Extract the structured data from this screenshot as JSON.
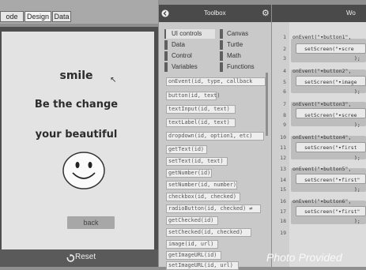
{
  "mode_tabs": [
    "ode",
    "Design",
    "Data"
  ],
  "app_screen": {
    "line1": "smile",
    "line2": "Be the change",
    "line3": "your beautiful",
    "back_label": "back",
    "reset_label": "Reset"
  },
  "toolbox": {
    "title": "Toolbox",
    "categories_left": [
      "UI controls",
      "Data",
      "Control",
      "Variables"
    ],
    "categories_right": [
      "Canvas",
      "Turtle",
      "Math",
      "Functions"
    ],
    "blocks": [
      "onEvent(id, type, callback",
      "button(id, text)",
      "textInput(id, text)",
      "textLabel(id, text)",
      "dropdown(id, option1, etc)",
      "getText(id)",
      "setText(id, text)",
      "getNumber(id)",
      "setNumber(id, number)",
      "checkbox(id, checked)",
      "radioButton(id, checked) ⇄",
      "getChecked(id)",
      "setChecked(id, checked)",
      "image(id, url)",
      "getImageURL(id)",
      "setImageURL(id, url)"
    ]
  },
  "workspace": {
    "title": "Wo",
    "line_numbers": [
      "1",
      "2",
      "3",
      "4",
      "5",
      "6",
      "7",
      "8",
      "9",
      "10",
      "11",
      "12",
      "13",
      "14",
      "15",
      "16",
      "17",
      "18",
      "19"
    ],
    "code": [
      "onEvent(\"▾button1\",",
      "setScreen(\"▾scre",
      ");",
      "onEvent(\"▾button2\",",
      "setScreen(\"▾image",
      ");",
      "onEvent(\"▾button3\",",
      "setScreen(\"▾scree",
      ");",
      "onEvent(\"▾button4\",",
      "setScreen(\"▾first",
      ");",
      "onEvent(\"▾button5\",",
      "setScreen(\"▾first\"",
      ");",
      "onEvent(\"▾button6\",",
      "setScreen(\"▾first\"",
      ");"
    ]
  },
  "watermark": "Photo Provided",
  "colors": {
    "dark_header": "#4a4a4a",
    "panel_grey": "#c9c9c9",
    "screen_bg": "#e3e3e3"
  }
}
